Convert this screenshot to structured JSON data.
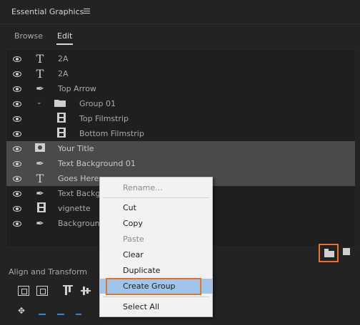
{
  "panel": {
    "title": "Essential Graphics",
    "menu_icon": "hamburger-icon"
  },
  "tabs": [
    {
      "label": "Browse",
      "active": false
    },
    {
      "label": "Edit",
      "active": true
    }
  ],
  "layers": [
    {
      "label": "2A",
      "icon": "text-icon",
      "indent": 0,
      "selected": false
    },
    {
      "label": "2A",
      "icon": "text-icon",
      "indent": 0,
      "selected": false
    },
    {
      "label": "Top Arrow",
      "icon": "pen-icon",
      "indent": 0,
      "selected": false
    },
    {
      "label": "Group 01",
      "icon": "folder-icon",
      "indent": 1,
      "selected": false
    },
    {
      "label": "Top Filmstrip",
      "icon": "filmstrip-icon",
      "indent": 2,
      "selected": false
    },
    {
      "label": "Bottom Filmstrip",
      "icon": "filmstrip-icon",
      "indent": 2,
      "selected": false
    },
    {
      "label": "Your Title",
      "icon": "image-icon",
      "indent": 0,
      "selected": true
    },
    {
      "label": "Text Background 01",
      "icon": "pen-icon",
      "indent": 0,
      "selected": true
    },
    {
      "label": "Goes Here",
      "icon": "text-icon",
      "indent": 0,
      "selected": true
    },
    {
      "label": "Text Backgr",
      "icon": "pen-icon",
      "indent": 0,
      "selected": false
    },
    {
      "label": "vignette",
      "icon": "filmstrip-icon",
      "indent": 0,
      "selected": false
    },
    {
      "label": "Background",
      "icon": "pen-icon",
      "indent": 0,
      "selected": false
    }
  ],
  "footer": {
    "section_title": "Align and Transform"
  },
  "context_menu": {
    "items": [
      {
        "label": "Rename...",
        "disabled": true
      },
      {
        "label": "Cut",
        "disabled": false
      },
      {
        "label": "Copy",
        "disabled": false
      },
      {
        "label": "Paste",
        "disabled": true
      },
      {
        "label": "Clear",
        "disabled": false
      },
      {
        "label": "Duplicate",
        "disabled": false
      },
      {
        "label": "Create Group",
        "disabled": false,
        "highlighted": true
      },
      {
        "label": "Select All",
        "disabled": false
      }
    ]
  },
  "colors": {
    "accent_highlight": "#e8712c",
    "menu_hover": "#9fc5eb",
    "selection_row": "#4a4a4a"
  }
}
